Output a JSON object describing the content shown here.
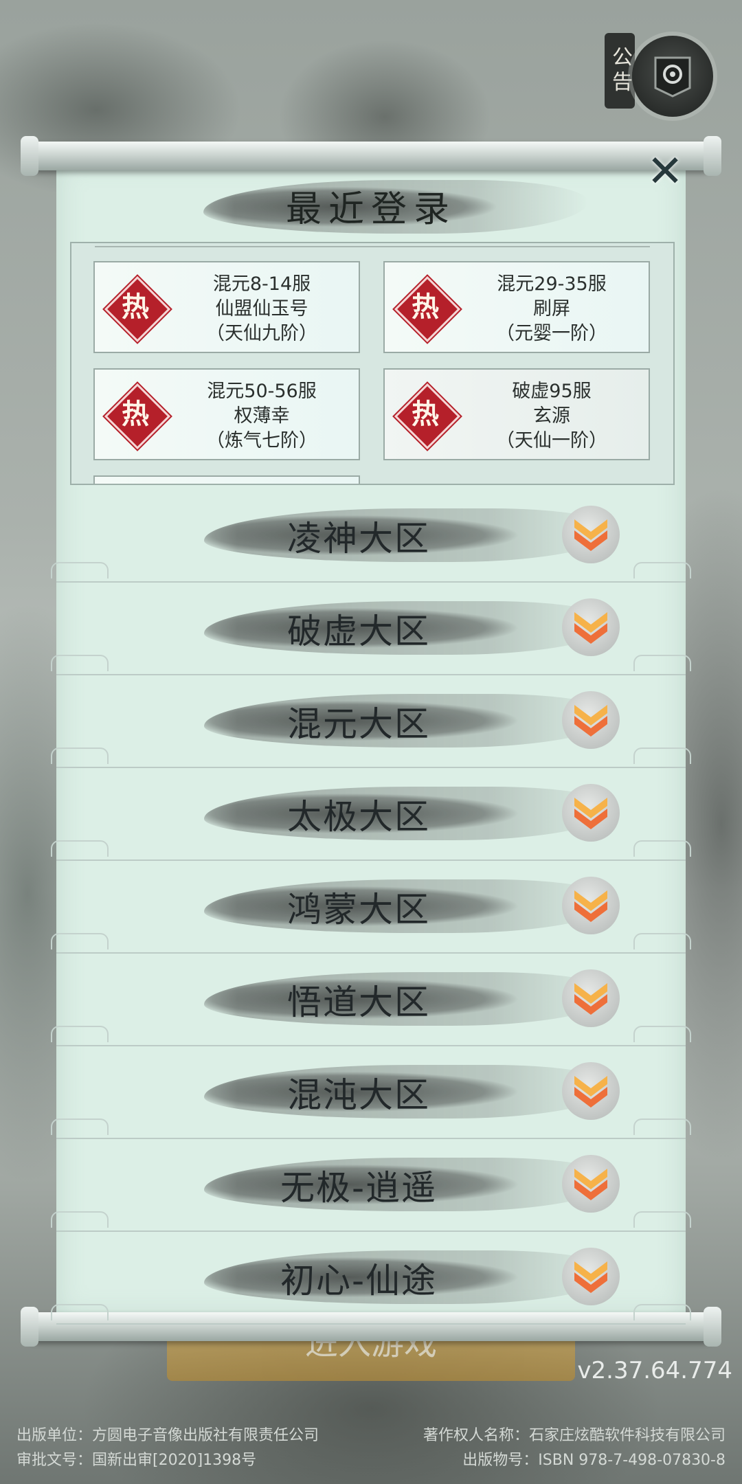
{
  "header": {
    "notice_label": "公告",
    "panel_title": "最近登录",
    "close_label": "✕"
  },
  "recent_servers": [
    {
      "badge": "热",
      "server": "混元8-14服",
      "character": "仙盟仙玉号",
      "rank": "（天仙九阶）"
    },
    {
      "badge": "热",
      "server": "混元29-35服",
      "character": "刷屏",
      "rank": "（元婴一阶）"
    },
    {
      "badge": "热",
      "server": "混元50-56服",
      "character": "权薄幸",
      "rank": "（炼气七阶）"
    },
    {
      "badge": "热",
      "server": "破虚95服",
      "character": "玄源",
      "rank": "（天仙一阶）"
    }
  ],
  "zones": [
    {
      "label": "凌神大区"
    },
    {
      "label": "破虚大区"
    },
    {
      "label": "混元大区"
    },
    {
      "label": "太极大区"
    },
    {
      "label": "鸿蒙大区"
    },
    {
      "label": "悟道大区"
    },
    {
      "label": "混沌大区"
    },
    {
      "label": "无极-逍遥"
    },
    {
      "label": "初心-仙途"
    }
  ],
  "background": {
    "enter_game_label": "进入游戏",
    "version": "v2.37.64.774",
    "footer": {
      "publisher": "出版单位：方圆电子音像出版社有限责任公司",
      "copyright": "著作权人名称：石家庄炫酷软件科技有限公司",
      "approval": "审批文号：国新出审[2020]1398号",
      "isbn": "出版物号：ISBN 978-7-498-07830-8"
    }
  },
  "colors": {
    "panel": "#dcefe6",
    "hot_badge": "#b5202a",
    "chevron": "#f08a3a"
  },
  "icons": {
    "notice": "seal-icon",
    "close": "close-icon",
    "hot": "hot-badge-icon",
    "expand": "double-chevron-down-icon"
  }
}
